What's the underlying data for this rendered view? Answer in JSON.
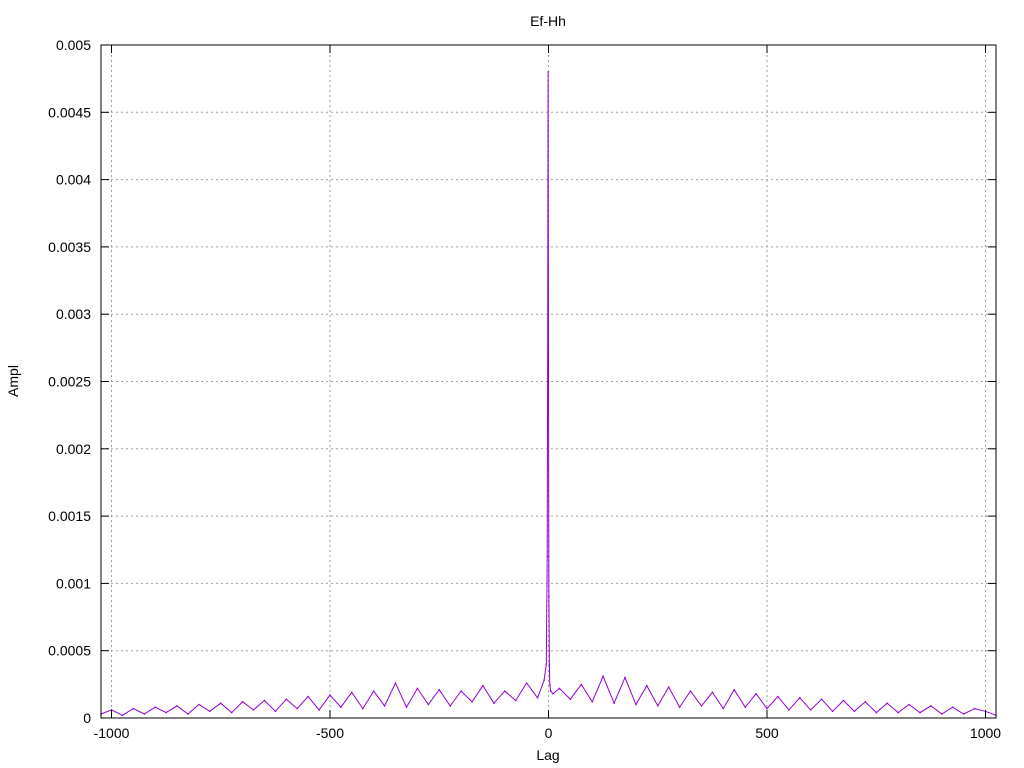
{
  "chart_data": {
    "type": "line",
    "title": "Ef-Hh",
    "xlabel": "Lag",
    "ylabel": "Ampl",
    "xlim": [
      -1024,
      1024
    ],
    "ylim": [
      0,
      0.005
    ],
    "grid": true,
    "legend": "none",
    "x_ticks": [
      -1000,
      -500,
      0,
      500,
      1000
    ],
    "x_tick_labels": [
      "-1000",
      "-500",
      "0",
      "500",
      "1000"
    ],
    "y_ticks": [
      0,
      0.0005,
      0.001,
      0.0015,
      0.002,
      0.0025,
      0.003,
      0.0035,
      0.004,
      0.0045,
      0.005
    ],
    "y_tick_labels": [
      "0",
      "0.0005",
      "0.001",
      "0.0015",
      "0.002",
      "0.0025",
      "0.003",
      "0.0035",
      "0.004",
      "0.0045",
      "0.005"
    ],
    "series": [
      {
        "color": "#9400d3",
        "x": [
          -1024,
          -1000,
          -975,
          -950,
          -925,
          -900,
          -875,
          -850,
          -825,
          -800,
          -775,
          -750,
          -725,
          -700,
          -675,
          -650,
          -625,
          -600,
          -575,
          -550,
          -525,
          -500,
          -475,
          -450,
          -425,
          -400,
          -375,
          -350,
          -325,
          -300,
          -275,
          -250,
          -225,
          -200,
          -175,
          -150,
          -125,
          -100,
          -75,
          -50,
          -25,
          -10,
          -5,
          -3,
          -2,
          -1,
          0,
          1,
          2,
          3,
          5,
          10,
          25,
          50,
          75,
          100,
          125,
          150,
          175,
          200,
          225,
          250,
          275,
          300,
          325,
          350,
          375,
          400,
          425,
          450,
          475,
          500,
          525,
          550,
          575,
          600,
          625,
          650,
          675,
          700,
          725,
          750,
          775,
          800,
          825,
          850,
          875,
          900,
          925,
          950,
          975,
          1000,
          1024
        ],
        "y": [
          3e-05,
          6e-05,
          2e-05,
          7e-05,
          3e-05,
          8e-05,
          4e-05,
          9e-05,
          3e-05,
          0.0001,
          5e-05,
          0.00011,
          4e-05,
          0.00012,
          6e-05,
          0.00013,
          5e-05,
          0.00014,
          7e-05,
          0.00016,
          6e-05,
          0.00017,
          8e-05,
          0.00019,
          7e-05,
          0.0002,
          9e-05,
          0.00026,
          8e-05,
          0.00022,
          0.0001,
          0.00021,
          9e-05,
          0.0002,
          0.00012,
          0.00024,
          0.00011,
          0.0002,
          0.00013,
          0.00026,
          0.00015,
          0.00028,
          0.0004,
          0.0012,
          0.0025,
          0.0048,
          0.0026,
          0.0009,
          0.0004,
          0.00025,
          0.0002,
          0.00018,
          0.00022,
          0.00014,
          0.00025,
          0.00012,
          0.00031,
          0.00011,
          0.0003,
          0.0001,
          0.00024,
          9e-05,
          0.00023,
          8e-05,
          0.0002,
          9e-05,
          0.00019,
          7e-05,
          0.00021,
          8e-05,
          0.00018,
          7e-05,
          0.00016,
          6e-05,
          0.00015,
          6e-05,
          0.00014,
          5e-05,
          0.00013,
          5e-05,
          0.00012,
          4e-05,
          0.00011,
          4e-05,
          0.0001,
          4e-05,
          9e-05,
          3e-05,
          8e-05,
          3e-05,
          7e-05,
          5e-05,
          2e-05
        ]
      }
    ]
  }
}
